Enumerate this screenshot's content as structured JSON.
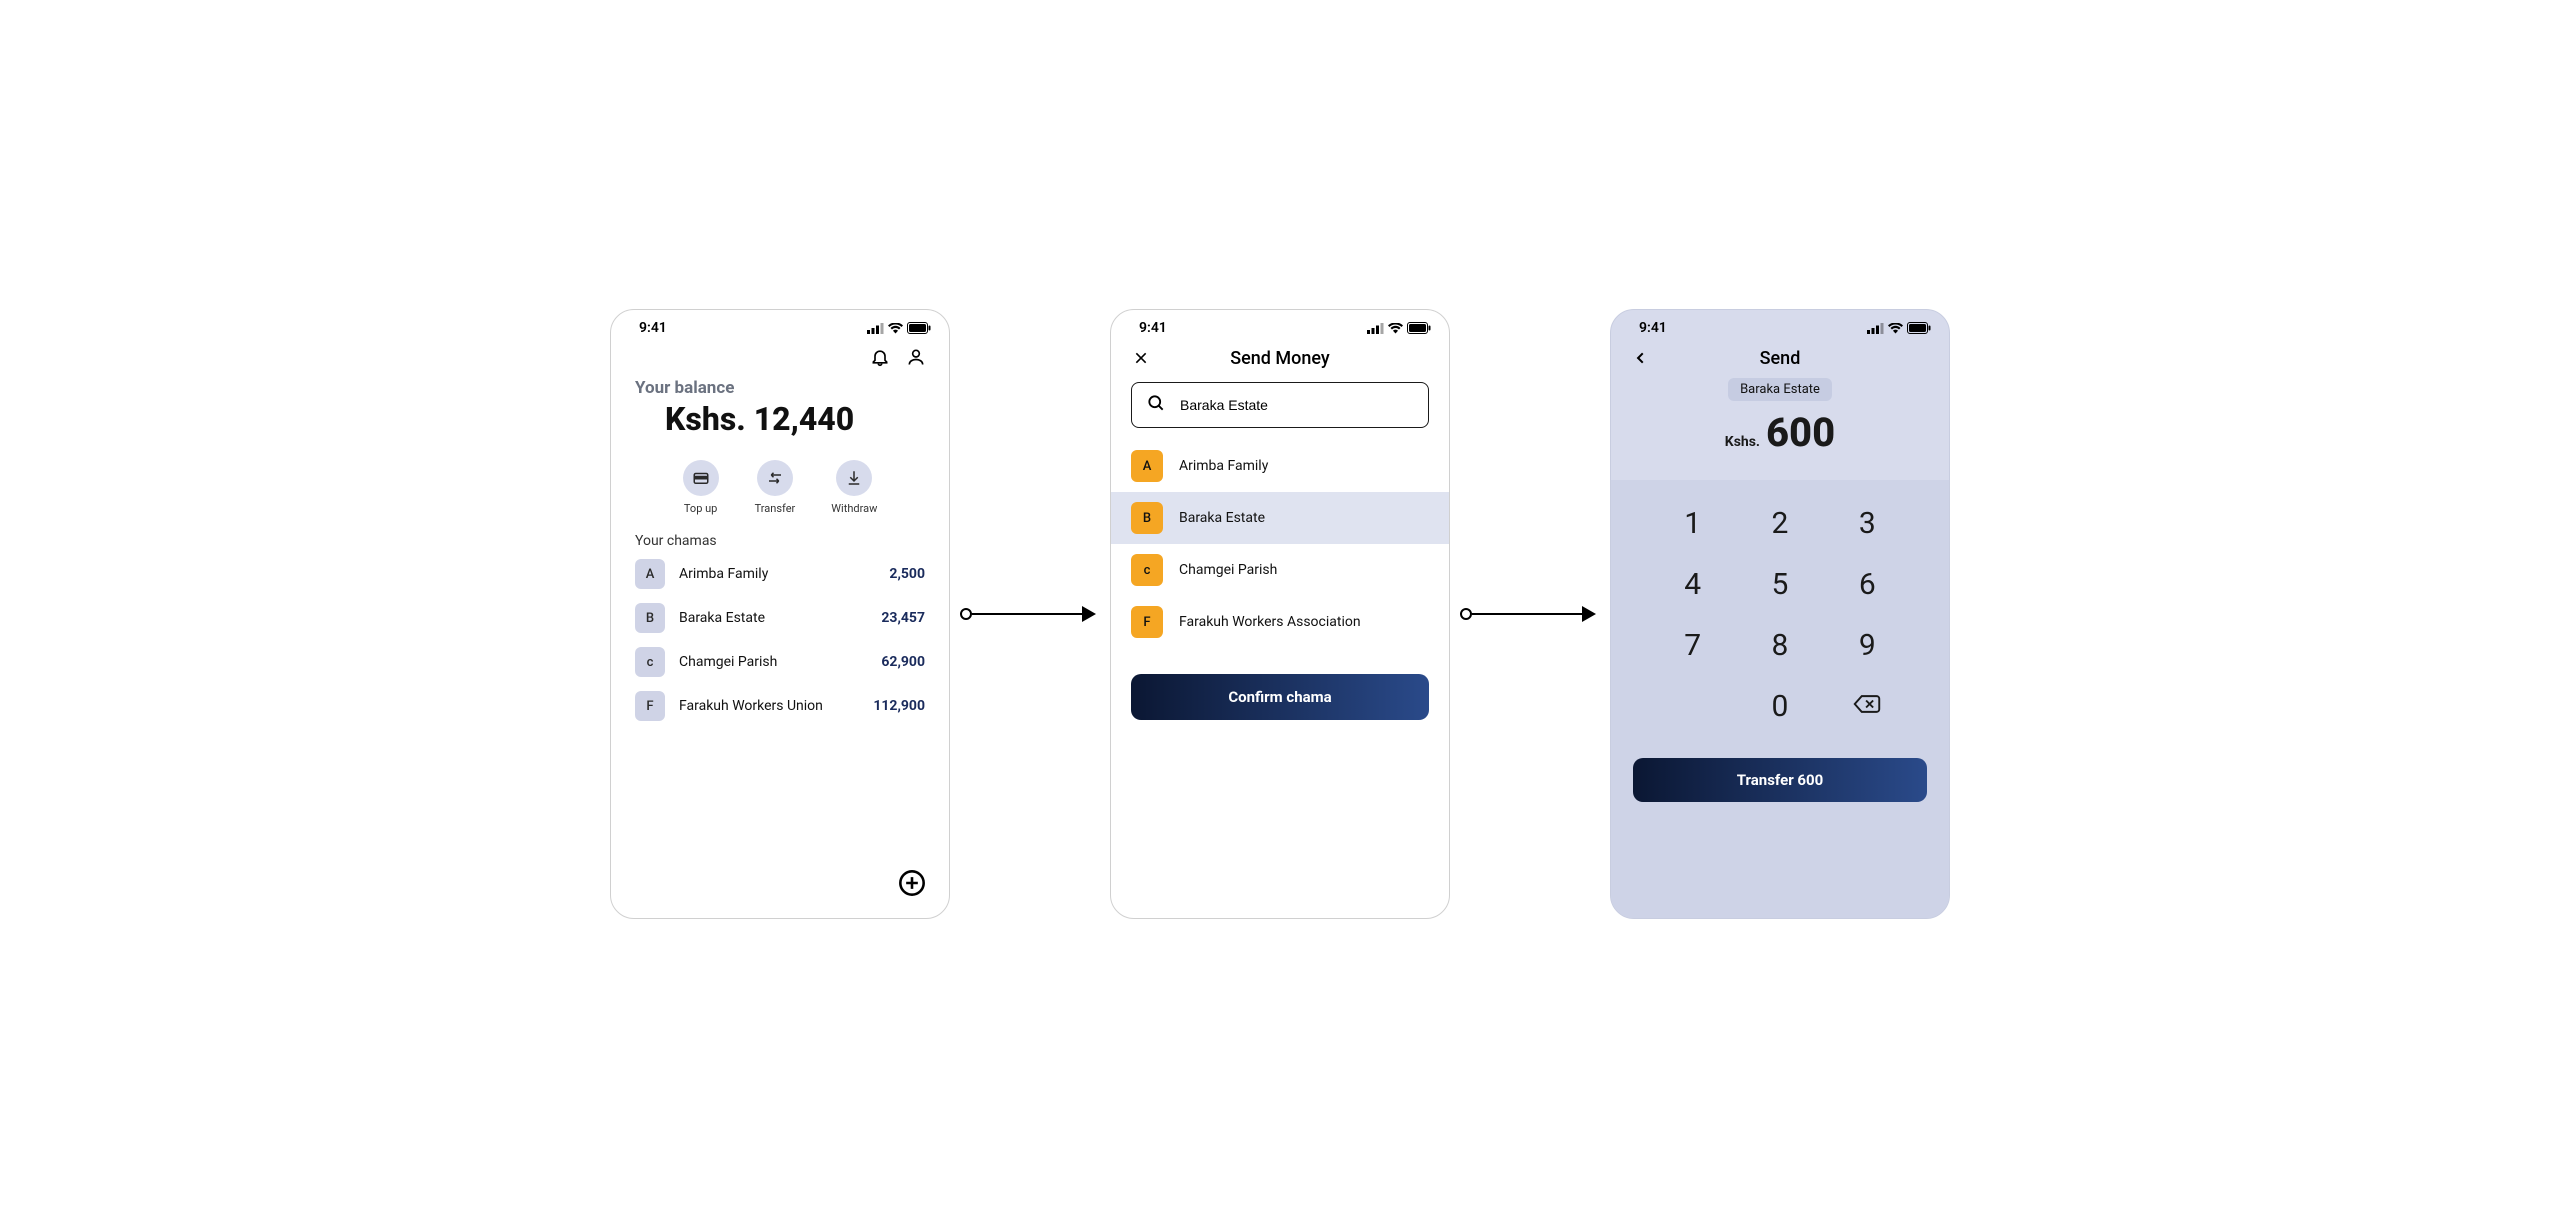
{
  "status_time": "9:41",
  "screen1": {
    "balance_label": "Your balance",
    "balance_amount": "Kshs. 12,440",
    "actions": {
      "topup": "Top up",
      "transfer": "Transfer",
      "withdraw": "Withdraw"
    },
    "section_title": "Your chamas",
    "chamas": [
      {
        "initial": "A",
        "name": "Arimba Family",
        "amount": "2,500"
      },
      {
        "initial": "B",
        "name": "Baraka Estate",
        "amount": "23,457"
      },
      {
        "initial": "c",
        "name": "Chamgei Parish",
        "amount": "62,900"
      },
      {
        "initial": "F",
        "name": "Farakuh Workers  Union",
        "amount": "112,900"
      }
    ]
  },
  "screen2": {
    "title": "Send Money",
    "search_value": "Baraka Estate",
    "items": [
      {
        "initial": "A",
        "name": "Arimba Family",
        "selected": false
      },
      {
        "initial": "B",
        "name": "Baraka Estate",
        "selected": true
      },
      {
        "initial": "c",
        "name": "Chamgei Parish",
        "selected": false
      },
      {
        "initial": "F",
        "name": "Farakuh Workers  Association",
        "selected": false
      }
    ],
    "confirm_label": "Confirm chama"
  },
  "screen3": {
    "title": "Send",
    "recipient_chip": "Baraka Estate",
    "currency": "Kshs.",
    "amount": "600",
    "keys": [
      "1",
      "2",
      "3",
      "4",
      "5",
      "6",
      "7",
      "8",
      "9",
      "",
      "0",
      "⌫"
    ],
    "transfer_label": "Transfer 600"
  }
}
